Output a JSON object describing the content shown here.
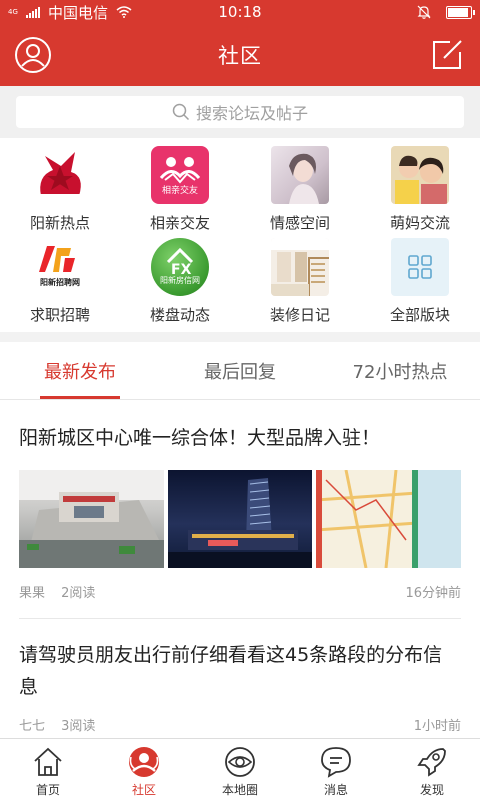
{
  "status_bar": {
    "network": "4G",
    "carrier": "中国电信",
    "time": "10:18",
    "battery_level": 0.9
  },
  "header": {
    "title": "社区",
    "left_icon": "user-icon",
    "right_icon": "compose-icon"
  },
  "search": {
    "placeholder": "搜索论坛及帖子",
    "icon": "search-icon"
  },
  "forums": [
    {
      "label": "阳新热点"
    },
    {
      "label": "相亲交友",
      "badge_text": "相亲交友"
    },
    {
      "label": "情感空间"
    },
    {
      "label": "萌妈交流"
    },
    {
      "label": "求职招聘",
      "badge_text": "阳新招聘网"
    },
    {
      "label": "楼盘动态",
      "badge_text": "阳新房信网"
    },
    {
      "label": "装修日记"
    },
    {
      "label": "全部版块"
    }
  ],
  "tabs": [
    {
      "label": "最新发布",
      "active": true
    },
    {
      "label": "最后回复",
      "active": false
    },
    {
      "label": "72小时热点",
      "active": false
    }
  ],
  "posts": [
    {
      "title": "阳新城区中心唯一综合体！大型品牌入驻！",
      "author": "果果",
      "reads": "2阅读",
      "time": "16分钟前"
    },
    {
      "title": "请驾驶员朋友出行前仔细看看这45条路段的分布信息",
      "author": "七七",
      "reads": "3阅读",
      "time": "1小时前"
    }
  ],
  "bottom_nav": [
    {
      "label": "首页",
      "icon": "home-icon",
      "active": false
    },
    {
      "label": "社区",
      "icon": "community-icon",
      "active": true
    },
    {
      "label": "本地圈",
      "icon": "eye-icon",
      "active": false
    },
    {
      "label": "消息",
      "icon": "message-icon",
      "active": false
    },
    {
      "label": "发现",
      "icon": "rocket-icon",
      "active": false
    }
  ],
  "colors": {
    "brand": "#d7392f",
    "text": "#333333",
    "muted": "#999999"
  }
}
